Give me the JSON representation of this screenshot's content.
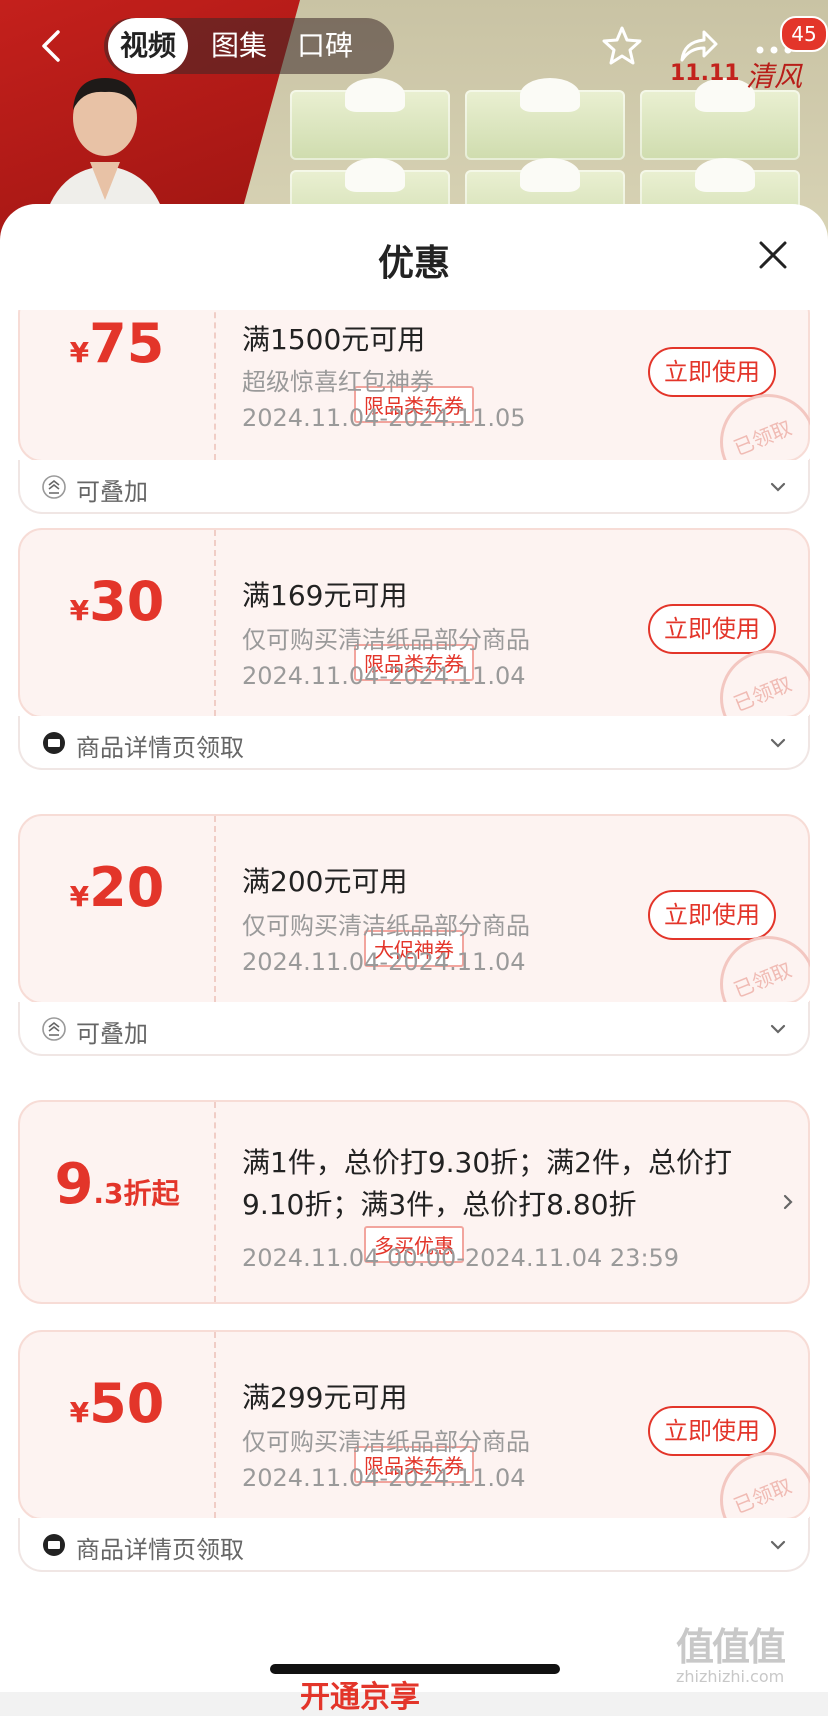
{
  "nav": {
    "tabs": [
      "视频",
      "图集",
      "口碑"
    ],
    "active_tab": 0,
    "cart_badge": "45",
    "brand_mark": "11.11 清风"
  },
  "sheet": {
    "title": "优惠"
  },
  "coupons": [
    {
      "yen": "¥",
      "amount": "75",
      "tag": "限品类东券",
      "condition": "满1500元可用",
      "description": "超级惊喜红包神券",
      "date": "2024.11.04-2024.11.05",
      "button": "立即使用",
      "stamp": "已领取",
      "footer": "可叠加"
    },
    {
      "yen": "¥",
      "amount": "30",
      "tag": "限品类东券",
      "condition": "满169元可用",
      "description": "仅可购买清洁纸品部分商品",
      "date": "2024.11.04-2024.11.04",
      "button": "立即使用",
      "stamp": "已领取",
      "footer": "商品详情页领取"
    },
    {
      "yen": "¥",
      "amount": "20",
      "tag": "大促神券",
      "condition": "满200元可用",
      "description": "仅可购买清洁纸品部分商品",
      "date": "2024.11.04-2024.11.04",
      "button": "立即使用",
      "stamp": "已领取",
      "footer": "可叠加"
    },
    {
      "amount_big": "9",
      "amount_rest": ".3折起",
      "tag": "多买优惠",
      "condition": "满1件，总价打9.30折；满2件，总价打9.10折；满3件，总价打8.80折",
      "date": "2024.11.04 00:00-2024.11.04 23:59"
    },
    {
      "yen": "¥",
      "amount": "50",
      "tag": "限品类东券",
      "condition": "满299元可用",
      "description": "仅可购买清洁纸品部分商品",
      "date": "2024.11.04-2024.11.04",
      "button": "立即使用",
      "stamp": "已领取",
      "footer": "商品详情页领取"
    }
  ],
  "bottom": {
    "peek_text": "开通京享"
  },
  "watermark": {
    "big": "值值值",
    "small": "zhizhizhi.com"
  },
  "colors": {
    "accent": "#e3352a",
    "card_bg": "#fdf3f1"
  }
}
